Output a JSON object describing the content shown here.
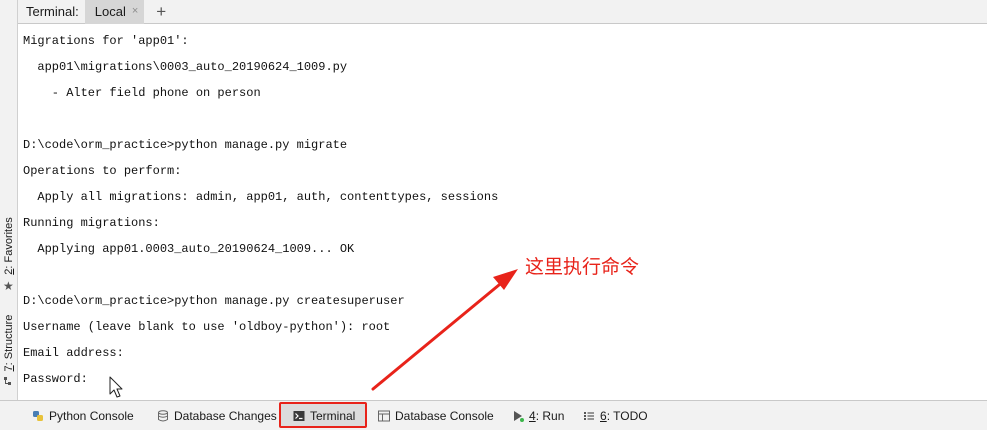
{
  "top_bar": {
    "label": "Terminal:",
    "tab_label": "Local",
    "close_glyph": "×",
    "add_glyph": "+"
  },
  "left_strip": {
    "favorites_num": "2",
    "favorites_label": ": Favorites",
    "structure_num": "7",
    "structure_label": ": Structure",
    "star_glyph": "★"
  },
  "terminal": {
    "lines": [
      "Migrations for 'app01':",
      "  app01\\migrations\\0003_auto_20190624_1009.py",
      "    - Alter field phone on person",
      "",
      "D:\\code\\orm_practice>python manage.py migrate",
      "Operations to perform:",
      "  Apply all migrations: admin, app01, auth, contenttypes, sessions",
      "Running migrations:",
      "  Applying app01.0003_auto_20190624_1009... OK",
      "",
      "D:\\code\\orm_practice>python manage.py createsuperuser",
      "Username (leave blank to use 'oldboy-python'): root",
      "Email address:",
      "Password:"
    ]
  },
  "annotation": {
    "text": "这里执行命令",
    "color": "#e8231a"
  },
  "bottom_bar": {
    "python_console": "Python Console",
    "database_changes": "Database Changes",
    "terminal": "Terminal",
    "database_console": "Database Console",
    "run_num": "4",
    "run_label": ": Run",
    "todo_num": "6",
    "todo_label": ": TODO"
  },
  "colors": {
    "highlight": "#e8231a",
    "toolbar_bg": "#f2f2f2"
  }
}
